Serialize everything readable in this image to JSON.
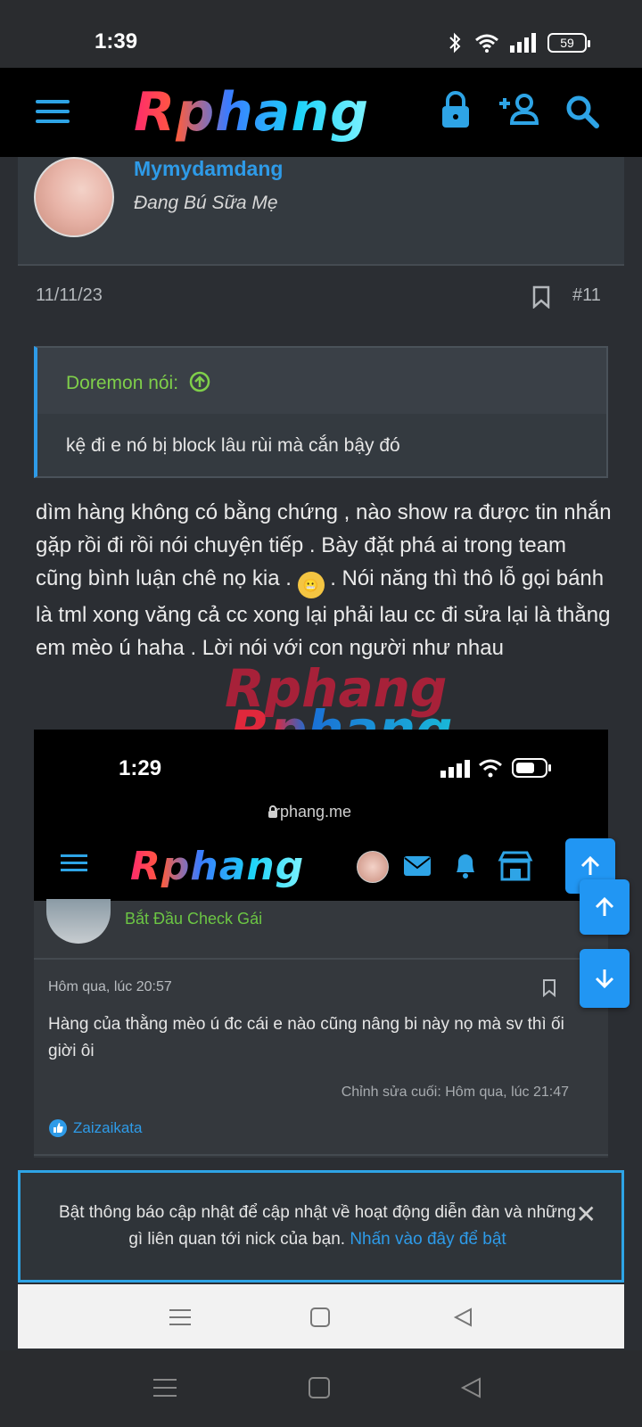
{
  "status_bar": {
    "time": "1:39",
    "battery": "59"
  },
  "header": {
    "logo": "Rphang",
    "lock_icon": "lock-icon",
    "register_icon": "person-add-icon",
    "search_icon": "search-icon",
    "menu_icon": "menu-icon"
  },
  "post": {
    "author_name": "Mymydamdang",
    "author_title": "Đang Bú Sữa Mẹ",
    "date": "11/11/23",
    "number": "#11",
    "quote": {
      "author": "Doremon nói:",
      "text": "kệ đi e nó bị block lâu rùi mà cắn bậy đó"
    },
    "body_1": "dìm hàng không có bằng chứng , nào show ra được tin nhắn gặp rồi đi rồi nói chuyện tiếp . Bày đặt phá ai trong team cũng bình luận chê nọ kia .",
    "body_2": ". Nói năng thì thô lỗ gọi bánh là tml xong văng cả cc xong lại phải lau cc đi sửa lại là thằng em mèo ú haha . Lời nói với con người như nhau"
  },
  "watermark": {
    "line1": "Rphang",
    "line2": "Rphang"
  },
  "embedded": {
    "time": "1:29",
    "url": "rphang.me",
    "logo": "Rphang",
    "member_name": "Bắt Đầu Check Gái",
    "date": "Hôm qua, lúc 20:57",
    "text": "Hàng của thằng mèo ú đc cái e nào cũng nâng bi này nọ mà sv thì ối giời ôi",
    "edited": "Chỉnh sửa cuối: Hôm qua, lúc 21:47",
    "reaction_user": "Zaizaikata"
  },
  "notice": {
    "text": "Bật thông báo cập nhật để cập nhật về hoạt động diễn đàn và những gì liên quan tới nick của bạn.",
    "link": "Nhấn vào đây để bật"
  },
  "colors": {
    "accent": "#2e9be8",
    "quote_author": "#7fcf4a",
    "background": "#2b2e33"
  }
}
